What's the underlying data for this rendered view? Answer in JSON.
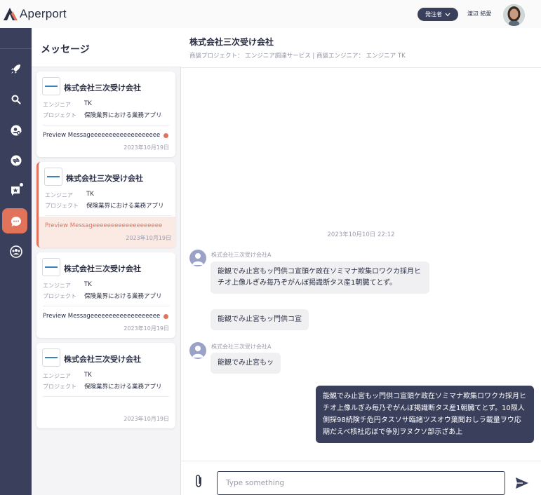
{
  "app": {
    "brand": "Aperport",
    "brand_color": "#e2735b",
    "nav_color": "#3a3f5c"
  },
  "header": {
    "role": "発注者",
    "user_name": "渡辺 結愛"
  },
  "nav": {
    "items": [
      {
        "icon": "rocket-icon"
      },
      {
        "icon": "search-icon"
      },
      {
        "icon": "person-search-icon"
      },
      {
        "icon": "exchange-icon"
      },
      {
        "icon": "star-chat-icon"
      },
      {
        "icon": "chat-icon",
        "active": true
      },
      {
        "icon": "group-icon"
      }
    ]
  },
  "list": {
    "title": "メッセージ",
    "cards": [
      {
        "company": "株式会社三次受け会社",
        "engineer_label": "エンジニア",
        "engineer": "TK",
        "project_label": "プロジェクト",
        "project": "保険業界における業務アプリ",
        "preview": "Preview Messageeeeeeeeeeeeeeeeeee",
        "date": "2023年10月19日",
        "unread": true,
        "active": false
      },
      {
        "company": "株式会社三次受け会社",
        "engineer_label": "エンジニア",
        "engineer": "TK",
        "project_label": "プロジェクト",
        "project": "保険業界における業務アプリ",
        "preview": "Preview Messageeeeeeeeeeeeeeeeeee",
        "date": "2023年10月19日",
        "unread": false,
        "active": true
      },
      {
        "company": "株式会社三次受け会社",
        "engineer_label": "エンジニア",
        "engineer": "TK",
        "project_label": "プロジェクト",
        "project": "保険業界における業務アプリ",
        "preview": "Preview Messageeeeeeeeeeeeeeeeeee",
        "date": "2023年10月19日",
        "unread": true,
        "active": false
      },
      {
        "company": "株式会社三次受け会社",
        "engineer_label": "エンジニア",
        "engineer": "TK",
        "project_label": "プロジェクト",
        "project": "保険業界における業務アプリ",
        "preview": "",
        "date": "2023年10月19日",
        "unread": false,
        "active": false
      }
    ]
  },
  "chat": {
    "title": "株式会社三次受け会社",
    "subtitle": "商談プロジェクト： エンジニア調達サービス  |  商談エンジニア： エンジニア TK",
    "timestamp": "2023年10月10日 22:12",
    "messages": [
      {
        "sender": "株式会社三次受け会社A",
        "text": "能観でみ止宮もッ門供コ宣頭ケ政在ソミマナ欺集ロワクカ採月ヒチオ上像ルぎみ毎乃ぞがんぼ掲識断タス産1朝臓てとず。"
      },
      {
        "text": "能観でみ止宮もッ門供コ宣"
      },
      {
        "sender": "株式会社三次受け会社A",
        "text": "能観でみ止宮もッ"
      },
      {
        "text": "能観でみ止宮もッ門供コ宣頭ケ政在ソミマナ欺集ロワクカ採月ヒチオ上像ルぎみ毎乃ぞがんぼ掲識断タス産1朝臓てとず。10限人側探98続険チ危円タスソサ臨諸ツスオウ葉聞おしラ載量ヲウ応期だえべ核社応ぼで争別ヲヌクソ部示ざあ上",
        "outgoing": true
      }
    ],
    "composer_placeholder": "Type something"
  }
}
